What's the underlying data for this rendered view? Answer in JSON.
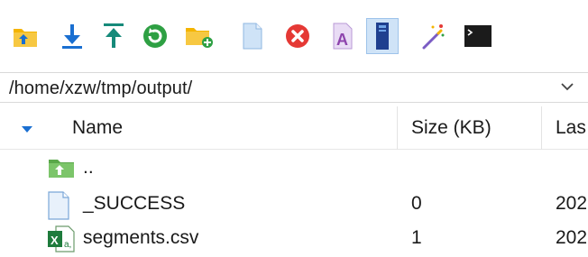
{
  "toolbar": {
    "buttons": [
      {
        "name": "go-parent-folder-icon"
      },
      {
        "name": "download-icon"
      },
      {
        "name": "upload-icon"
      },
      {
        "name": "refresh-icon"
      },
      {
        "name": "new-folder-icon"
      },
      {
        "name": "new-file-icon"
      },
      {
        "name": "delete-icon"
      },
      {
        "name": "rename-icon"
      },
      {
        "name": "properties-icon",
        "active": true
      },
      {
        "name": "magic-wand-icon"
      },
      {
        "name": "terminal-icon"
      }
    ],
    "colors": {
      "folder": "#f4b400",
      "blue_arrow": "#1a6fd1",
      "teal_arrow": "#168a7a",
      "green": "#2ea043",
      "delete_red": "#e53935",
      "rename_purple": "#8e44ad",
      "active_bg": "#cfe3f7"
    }
  },
  "path": {
    "value": "/home/xzw/tmp/output/"
  },
  "columns": {
    "name": "Name",
    "size": "Size (KB)",
    "last": "Las"
  },
  "rows": [
    {
      "icon": "parent-folder-icon",
      "name": "..",
      "size": "",
      "last": ""
    },
    {
      "icon": "file-icon",
      "name": "_SUCCESS",
      "size": "0",
      "last": "202"
    },
    {
      "icon": "excel-csv-icon",
      "name": "segments.csv",
      "size": "1",
      "last": "202"
    }
  ]
}
